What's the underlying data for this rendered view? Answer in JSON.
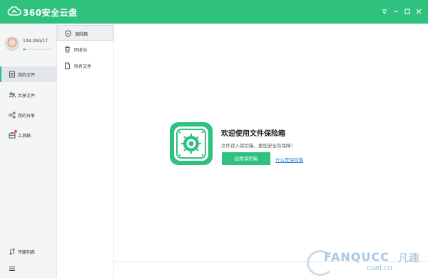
{
  "app": {
    "title": "360安全云盘",
    "brand_color": "#2ec27e"
  },
  "window_controls": [
    "menu-icon",
    "minimize-icon",
    "maximize-icon",
    "close-icon"
  ],
  "account": {
    "quota_text": "104.29G/1T",
    "quota_used_fraction": 0.1
  },
  "sidebar": {
    "items": [
      {
        "label": "我的文件",
        "icon": "file-icon",
        "active": true
      },
      {
        "label": "共享文件",
        "icon": "shared-users-icon",
        "active": false
      },
      {
        "label": "我的分享",
        "icon": "share-icon",
        "active": false
      },
      {
        "label": "工具箱",
        "icon": "toolbox-icon",
        "active": false,
        "badge": true
      }
    ],
    "bottom": {
      "transfer_label": "传输列表",
      "transfer_icon": "transfer-icon",
      "menu_icon": "hamburger-menu-icon"
    }
  },
  "subnav": {
    "items": [
      {
        "label": "保险箱",
        "icon": "shield-icon",
        "active": true
      },
      {
        "label": "回收站",
        "icon": "trash-icon",
        "active": false
      },
      {
        "label": "所有文件",
        "icon": "document-icon",
        "active": false
      }
    ]
  },
  "vault": {
    "title": "欢迎使用文件保险箱",
    "subtitle": "文件存入保险箱，更加安全有保障！",
    "enable_button": "启用保险箱",
    "what_link": "什么是保险箱",
    "icon": "safe-icon"
  },
  "watermark": {
    "main": "FANQUCC",
    "sub": "cuel.cn",
    "cn": "凡趣"
  }
}
